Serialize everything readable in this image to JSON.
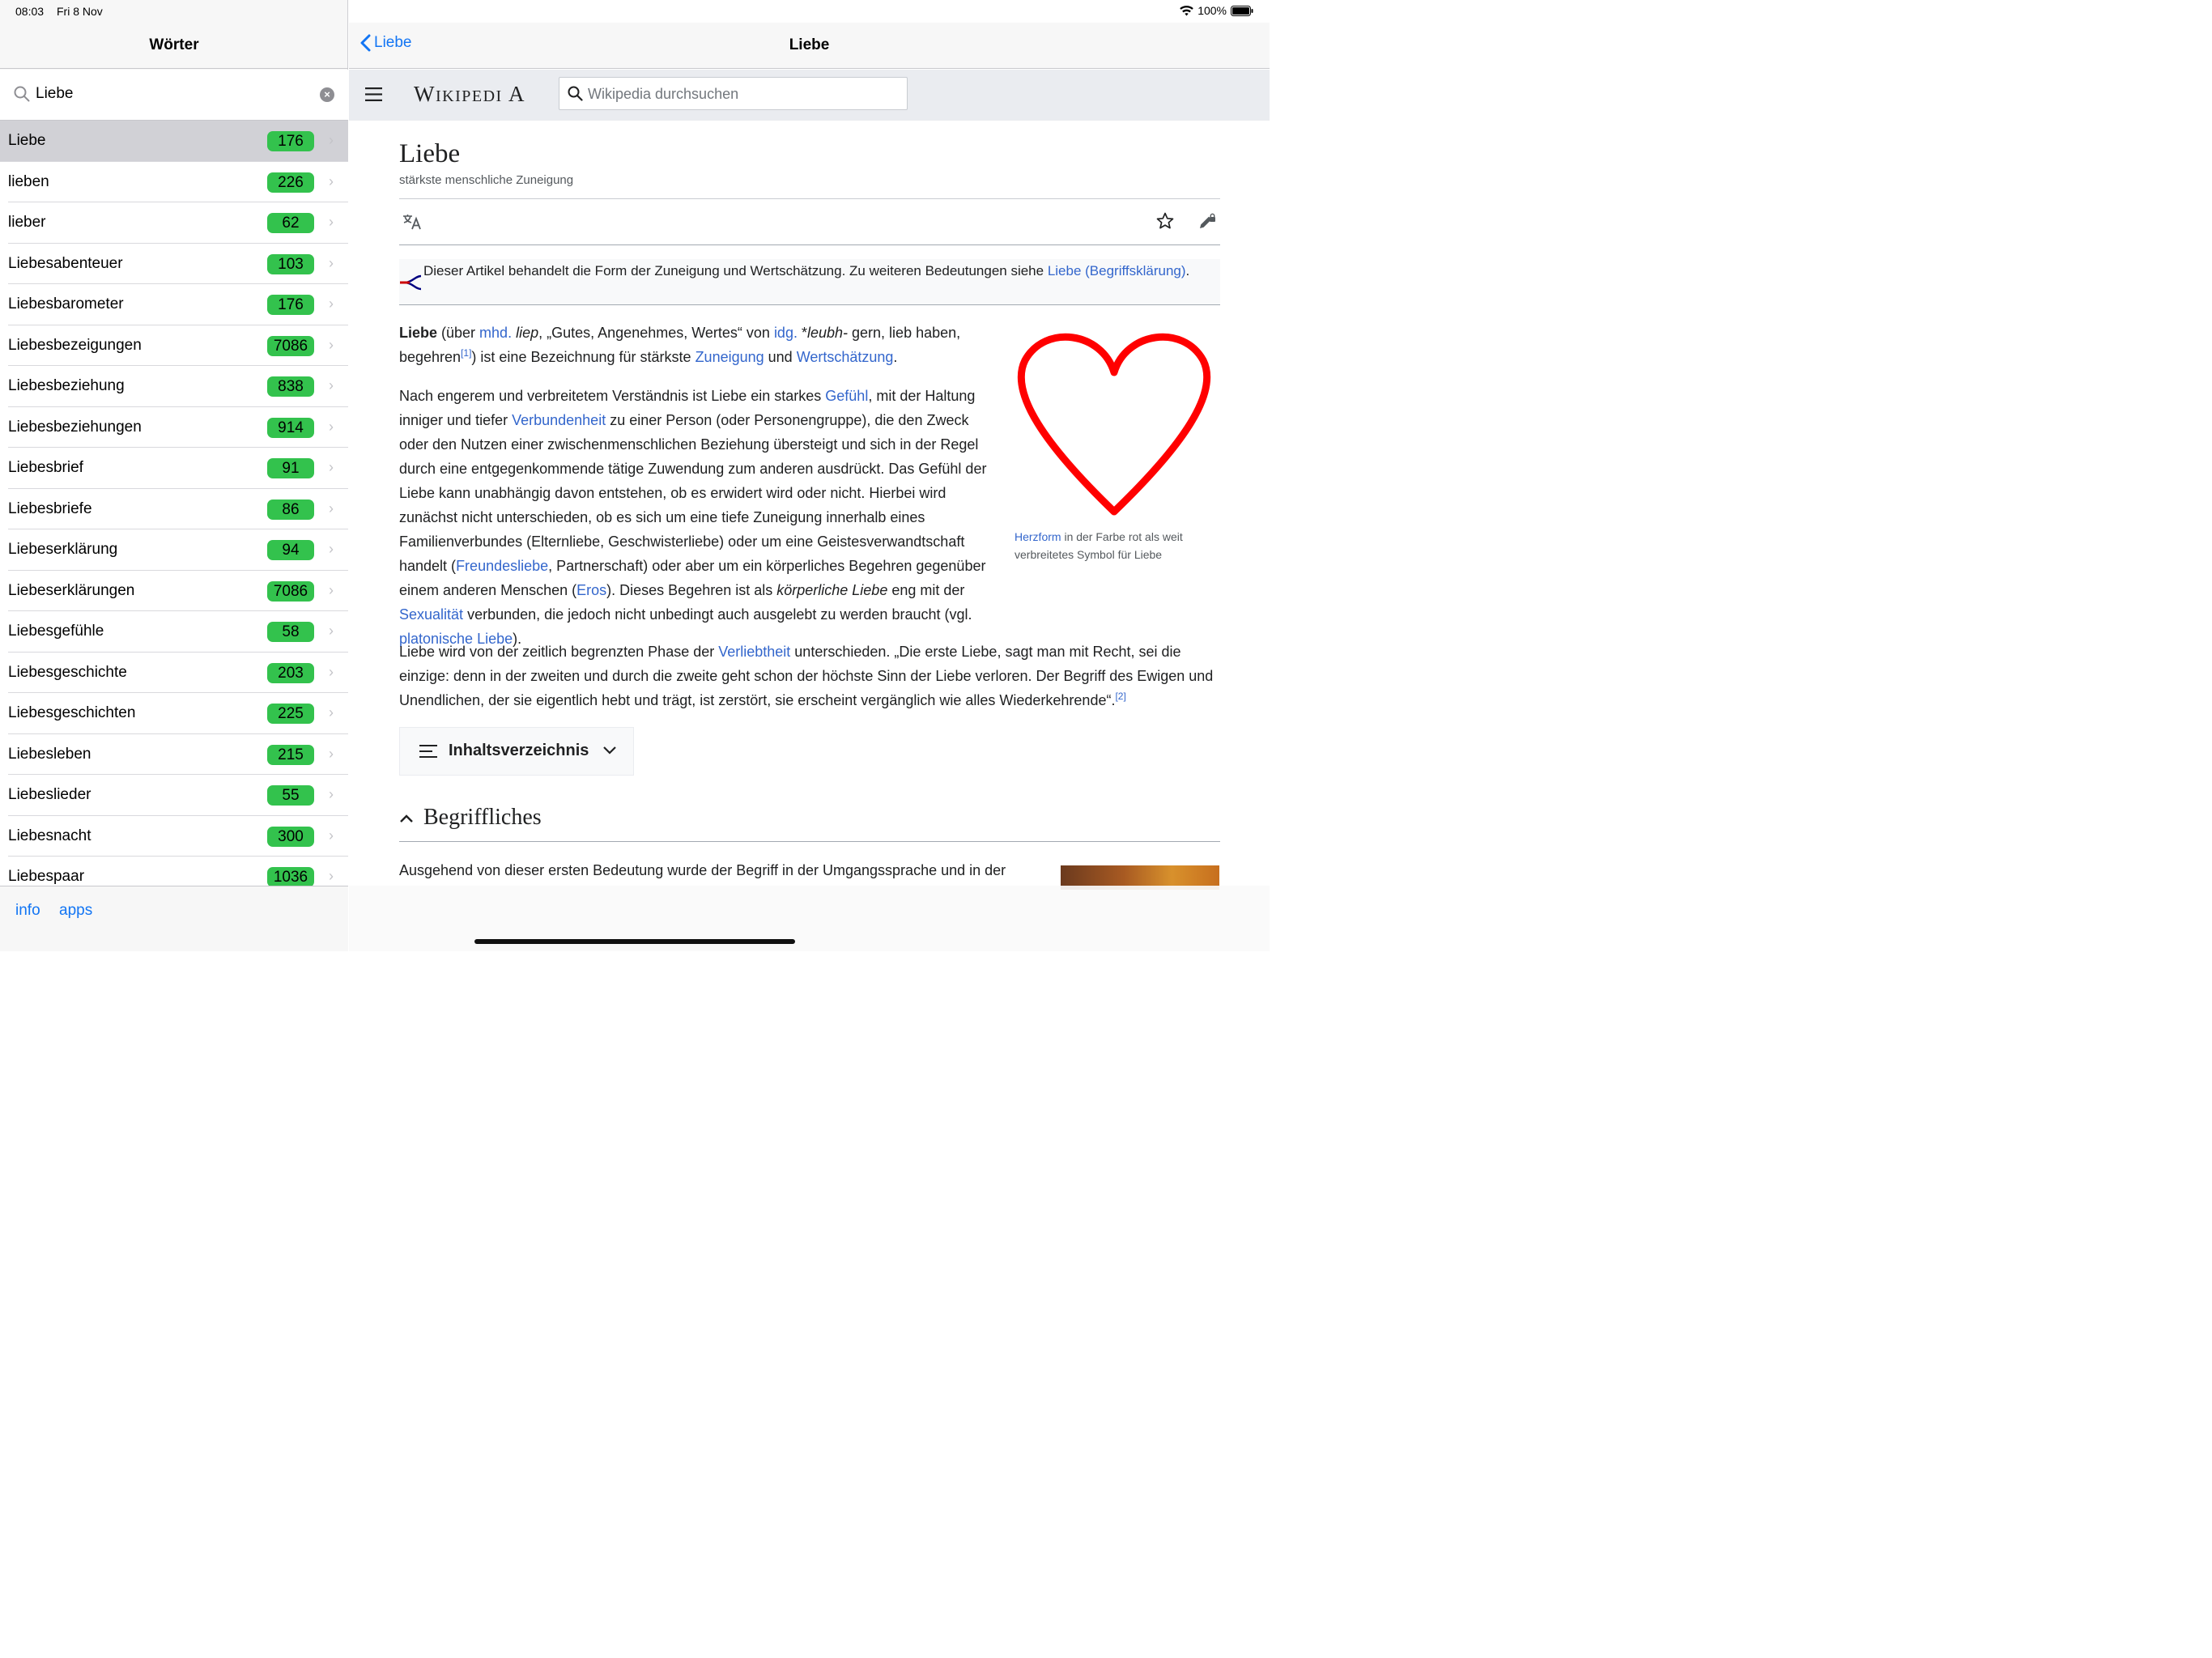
{
  "status": {
    "time": "08:03",
    "date": "Fri 8 Nov",
    "battery": "100%"
  },
  "master": {
    "title": "Wörter",
    "search_value": "Liebe",
    "items": [
      {
        "label": "Liebe",
        "count": "176",
        "selected": true
      },
      {
        "label": "lieben",
        "count": "226"
      },
      {
        "label": "lieber",
        "count": "62"
      },
      {
        "label": "Liebesabenteuer",
        "count": "103"
      },
      {
        "label": "Liebesbarometer",
        "count": "176"
      },
      {
        "label": "Liebesbezeigungen",
        "count": "7086"
      },
      {
        "label": "Liebesbeziehung",
        "count": "838"
      },
      {
        "label": "Liebesbeziehungen",
        "count": "914"
      },
      {
        "label": "Liebesbrief",
        "count": "91"
      },
      {
        "label": "Liebesbriefe",
        "count": "86"
      },
      {
        "label": "Liebeserklärung",
        "count": "94"
      },
      {
        "label": "Liebeserklärungen",
        "count": "7086"
      },
      {
        "label": "Liebesgefühle",
        "count": "58"
      },
      {
        "label": "Liebesgeschichte",
        "count": "203"
      },
      {
        "label": "Liebesgeschichten",
        "count": "225"
      },
      {
        "label": "Liebesleben",
        "count": "215"
      },
      {
        "label": "Liebeslieder",
        "count": "55"
      },
      {
        "label": "Liebesnacht",
        "count": "300"
      },
      {
        "label": "Liebespaar",
        "count": "1036"
      }
    ],
    "tabs": {
      "info": "info",
      "apps": "apps"
    }
  },
  "detail": {
    "back_label": "Liebe",
    "title": "Liebe",
    "wiki_logo": "Wikipedia",
    "search_placeholder": "Wikipedia durchsuchen",
    "article_title": "Liebe",
    "tagline": "stärkste menschliche Zuneigung",
    "hatnote": {
      "text": "Dieser Artikel behandelt die Form der Zuneigung und Wertschätzung. Zu weiteren Bedeutungen siehe ",
      "link": "Liebe (Begriffsklärung)",
      "end": "."
    },
    "para1": {
      "bold": "Liebe",
      "t1": " (über ",
      "l1": "mhd.",
      "t2": " ",
      "i1": "liep",
      "t3": ", „Gutes, Angenehmes, Wertes“ von ",
      "l2": "idg.",
      "t4": " *",
      "i2": "leubh-",
      "t5": " gern, lieb haben, begehren",
      "ref": "[1]",
      "t6": ") ist eine Bezeichnung für stärkste ",
      "l3": "Zuneigung",
      "t7": " und ",
      "l4": "Wertschätzung",
      "t8": "."
    },
    "para2": {
      "t1": "Nach engerem und verbreitetem Verständnis ist Liebe ein starkes ",
      "l1": "Gefühl",
      "t2": ", mit der Haltung inniger und tiefer ",
      "l2": "Verbundenheit",
      "t3": " zu einer Person (oder Personengruppe), die den Zweck oder den Nutzen einer zwischenmenschlichen Beziehung übersteigt und sich in der Regel durch eine entgegenkommende tätige Zuwendung zum anderen ausdrückt. Das Gefühl der Liebe kann unabhängig davon entstehen, ob es erwidert wird oder nicht. Hierbei wird zunächst nicht unterschieden, ob es sich um eine tiefe Zuneigung innerhalb eines Familienverbundes (Elternliebe, Geschwisterliebe) oder um eine Geistesverwandtschaft handelt (",
      "l3": "Freundesliebe",
      "t4": ", Partnerschaft) oder aber um ein körperliches Begehren gegenüber einem anderen Menschen (",
      "l4": "Eros",
      "t5": "). Dieses Begehren ist als ",
      "i1": "körperliche Liebe",
      "t6": " eng mit der ",
      "l5": "Sexualität",
      "t7": " verbunden, die jedoch nicht unbedingt auch ausgelebt zu werden braucht (vgl. ",
      "l6": "platonische Liebe",
      "t8": ")."
    },
    "para3": {
      "t1": "Liebe wird von der zeitlich begrenzten Phase der ",
      "l1": "Verliebtheit",
      "t2": " unterschieden. „Die erste Liebe, sagt man mit Recht, sei die einzige: denn in der zweiten und durch die zweite geht schon der höchste Sinn der Liebe verloren. Der Begriff des Ewigen und Unendlichen, der sie eigentlich hebt und trägt, ist zerstört, sie erscheint vergänglich wie alles Wiederkehrende“.",
      "ref": "[2]"
    },
    "figure": {
      "cap_link": "Herzform",
      "cap_text": " in der Farbe rot als weit verbreitetes Symbol für Liebe",
      "heart_color": "#ff0000"
    },
    "toc_label": "Inhaltsverzeichnis",
    "section_title": "Begriffliches",
    "para4": "Ausgehend von dieser ersten Bedeutung wurde der Begriff in der Umgangssprache und in der"
  }
}
